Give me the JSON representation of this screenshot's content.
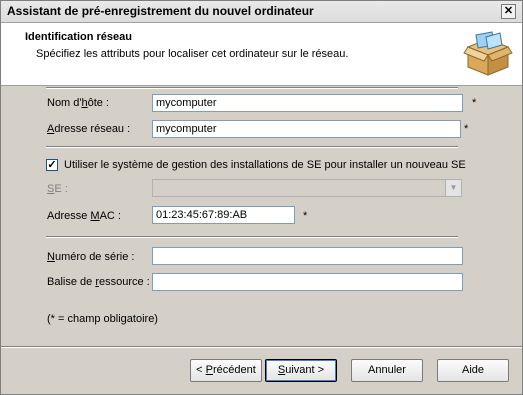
{
  "window": {
    "title": "Assistant de pré-enregistrement du nouvel ordinateur",
    "close_symbol": "✕"
  },
  "header": {
    "title": "Identification réseau",
    "subtitle": "Spécifiez les attributs pour localiser cet ordinateur sur le réseau.",
    "icon": "package-box-icon"
  },
  "form": {
    "hostname": {
      "label_pre": "Nom d'",
      "label_u": "h",
      "label_post": "ôte :",
      "value": "mycomputer",
      "required": "*"
    },
    "network_address": {
      "label_pre": "",
      "label_u": "A",
      "label_post": "dresse réseau :",
      "value": "mycomputer",
      "required": "*"
    },
    "use_os_install": {
      "checked": true,
      "label": "Utiliser le système de gestion des installations de SE pour installer un nouveau SE"
    },
    "os": {
      "label_pre": "",
      "label_u": "S",
      "label_post": "E :",
      "value": "",
      "enabled": false
    },
    "mac": {
      "label_pre": "Adresse ",
      "label_u": "M",
      "label_post": "AC :",
      "value": "01:23:45:67:89:AB",
      "required": "*"
    },
    "serial": {
      "label_pre": "",
      "label_u": "N",
      "label_post": "uméro de série :",
      "value": ""
    },
    "asset_tag": {
      "label_pre": "Balise de ",
      "label_u": "r",
      "label_post": "essource :",
      "value": ""
    },
    "note": "(* = champ obligatoire)"
  },
  "buttons": {
    "previous": {
      "pre": "< ",
      "u": "P",
      "post": "récédent"
    },
    "next": {
      "pre": "",
      "u": "S",
      "post": "uivant >"
    },
    "cancel": "Annuler",
    "help": "Aide"
  }
}
